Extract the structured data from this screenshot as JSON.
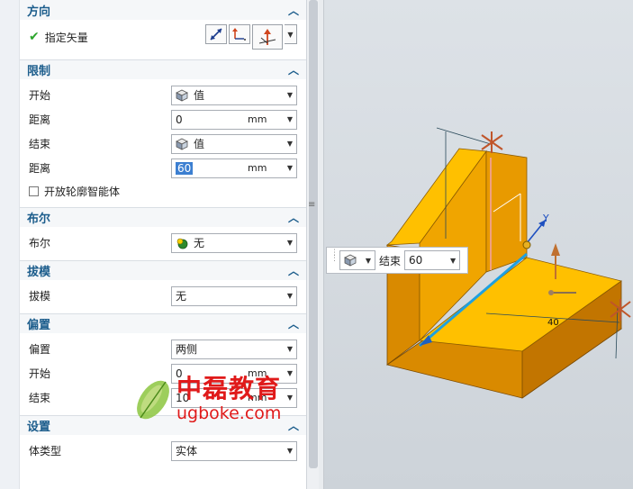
{
  "sections": {
    "direction": {
      "title": "方向",
      "specify_vector": "指定矢量"
    },
    "limits": {
      "title": "限制",
      "start_label": "开始",
      "start_value": "值",
      "distance1_label": "距离",
      "distance1_value": "0",
      "distance1_unit": "mm",
      "end_label": "结束",
      "end_value": "值",
      "distance2_label": "距离",
      "distance2_value": "60",
      "distance2_unit": "mm",
      "open_profile_label": "开放轮廓智能体"
    },
    "boolean": {
      "title": "布尔",
      "label": "布尔",
      "value": "无"
    },
    "draft": {
      "title": "拔模",
      "label": "拔模",
      "value": "无"
    },
    "offset": {
      "title": "偏置",
      "offset_label": "偏置",
      "offset_value": "两侧",
      "start_label": "开始",
      "start_value": "0",
      "start_unit": "mm",
      "end_label": "结束",
      "end_value": "10",
      "end_unit": "mm"
    },
    "settings": {
      "title": "设置",
      "body_type_label": "体类型",
      "body_type_value": "实体"
    }
  },
  "floating_bar": {
    "end_label": "结束",
    "end_value": "60"
  },
  "viewport": {
    "dim_40": "40",
    "axis_y": "Y"
  },
  "watermark": {
    "cn": "中磊教育",
    "url": "ugboke.com"
  },
  "colors": {
    "section_title": "#1c5d8c",
    "solid_top": "#ffc000",
    "solid_side": "#d98a00",
    "accent_blue": "#3c7fd1",
    "watermark_red": "#e01a1a"
  }
}
